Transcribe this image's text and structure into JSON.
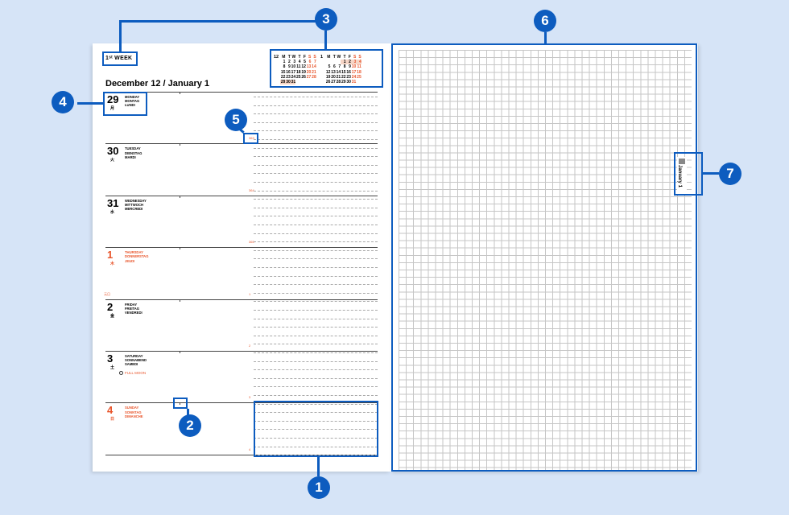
{
  "planner": {
    "week_label": "1ˢᵗ WEEK",
    "title": "December 12 /  January 1",
    "month_tab": "January 1",
    "mini_calendar": {
      "months": [
        {
          "number": "12",
          "header": [
            "M",
            "T",
            "W",
            "T",
            "F",
            "S",
            "S"
          ],
          "rows": [
            [
              "",
              "",
              "",
              "1",
              "2",
              "3",
              "4"
            ],
            [
              "",
              "",
              "",
              "",
              "",
              "",
              ""
            ],
            [
              "",
              "",
              "",
              "",
              "",
              "",
              ""
            ],
            [
              "",
              "",
              "",
              "",
              "",
              "",
              ""
            ],
            [
              "",
              "",
              "",
              "",
              "",
              "",
              ""
            ]
          ]
        },
        {
          "number": "1",
          "header": [
            "M",
            "T",
            "W",
            "T",
            "F",
            "S",
            "S"
          ],
          "rows": [
            [
              "",
              "",
              "",
              "",
              "",
              "",
              ""
            ],
            [
              "",
              "",
              "",
              "",
              "",
              "",
              ""
            ],
            [
              "",
              "",
              "",
              "",
              "",
              "",
              ""
            ],
            [
              "",
              "",
              "",
              "",
              "",
              "",
              ""
            ],
            [
              "",
              "",
              "",
              "",
              "",
              "",
              ""
            ]
          ]
        }
      ],
      "dec_rows": [
        [
          "",
          "1",
          "2",
          "3",
          "4",
          "5",
          "6",
          "7"
        ],
        [
          "",
          "8",
          "9",
          "10",
          "11",
          "12",
          "13",
          "14"
        ],
        [
          "",
          "15",
          "16",
          "17",
          "18",
          "19",
          "20",
          "21"
        ],
        [
          "",
          "22",
          "23",
          "24",
          "25",
          "26",
          "27",
          "28"
        ],
        [
          "",
          "29",
          "30",
          "31",
          "",
          "",
          "",
          ""
        ]
      ],
      "jan_rows": [
        [
          "",
          "",
          "",
          "",
          "1",
          "2",
          "3",
          "4"
        ],
        [
          "",
          "5",
          "6",
          "7",
          "8",
          "9",
          "10",
          "11"
        ],
        [
          "",
          "12",
          "13",
          "14",
          "15",
          "16",
          "17",
          "18"
        ],
        [
          "",
          "19",
          "20",
          "21",
          "22",
          "23",
          "24",
          "25"
        ],
        [
          "",
          "26",
          "27",
          "28",
          "29",
          "30",
          "31",
          ""
        ]
      ]
    },
    "days": [
      {
        "date": "29",
        "kanji": "月",
        "names": [
          "MONDAY",
          "MONTAG",
          "LUNDI"
        ],
        "count": "363",
        "holiday": false
      },
      {
        "date": "30",
        "kanji": "火",
        "names": [
          "TUESDAY",
          "DIENSTAG",
          "MARDI"
        ],
        "count": "364",
        "holiday": false
      },
      {
        "date": "31",
        "kanji": "水",
        "names": [
          "WEDNESDAY",
          "MITTWOCH",
          "MERCREDI"
        ],
        "count": "365",
        "holiday": false
      },
      {
        "date": "1",
        "kanji": "木",
        "names": [
          "THURSDAY",
          "DONNERSTAG",
          "JEUDI"
        ],
        "count": "1",
        "holiday": true,
        "side_note": "元日"
      },
      {
        "date": "2",
        "kanji": "金",
        "names": [
          "FRIDAY",
          "FREITAG",
          "VENDREDI"
        ],
        "count": "2",
        "holiday": false
      },
      {
        "date": "3",
        "kanji": "土",
        "names": [
          "SATURDAY",
          "SONNABEND",
          "SAMEDI"
        ],
        "count": "3",
        "holiday": false,
        "moon": "FULL MOON"
      },
      {
        "date": "4",
        "kanji": "日",
        "names": [
          "SUNDAY",
          "SONNTAG",
          "DIMANCHE"
        ],
        "count": "4",
        "holiday": true
      }
    ]
  },
  "callouts": [
    "1",
    "2",
    "3",
    "4",
    "5",
    "6",
    "7"
  ],
  "colors": {
    "accent": "#0d5cbf",
    "holiday": "#e8542a",
    "background": "#d6e4f7"
  }
}
